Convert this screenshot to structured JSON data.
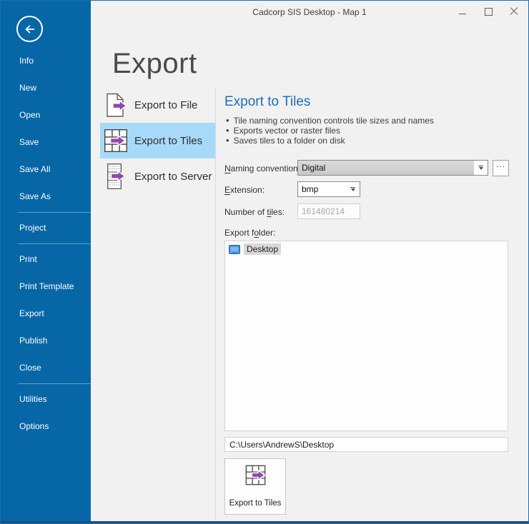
{
  "window": {
    "title": "Cadcorp SIS Desktop - Map 1"
  },
  "sidebar": {
    "items": [
      {
        "label": "Info"
      },
      {
        "label": "New"
      },
      {
        "label": "Open"
      },
      {
        "label": "Save"
      },
      {
        "label": "Save All"
      },
      {
        "label": "Save As"
      },
      {
        "label": "Project"
      },
      {
        "label": "Print"
      },
      {
        "label": "Print Template"
      },
      {
        "label": "Export"
      },
      {
        "label": "Publish"
      },
      {
        "label": "Close"
      },
      {
        "label": "Utilities"
      },
      {
        "label": "Options"
      }
    ]
  },
  "page": {
    "title": "Export"
  },
  "nav": {
    "items": [
      {
        "label": "Export to File"
      },
      {
        "label": "Export to Tiles"
      },
      {
        "label": "Export to Server"
      }
    ],
    "selected_index": 1
  },
  "panel": {
    "title": "Export to Tiles",
    "bullets": [
      "Tile naming convention controls tile sizes and names",
      "Exports vector or raster files",
      "Saves tiles to a folder on disk"
    ],
    "naming_convention": {
      "label_pre": "",
      "label_mnemonic": "N",
      "label_post": "aming convention:",
      "value": "Digital",
      "browse_label": "..."
    },
    "extension": {
      "label_pre": "",
      "label_mnemonic": "E",
      "label_post": "xtension:",
      "value": "bmp"
    },
    "number_of_tiles": {
      "label_pre": "Number of ",
      "label_mnemonic": "ti",
      "label_post": "les:",
      "value": "161480214"
    },
    "export_folder": {
      "label_pre": "Export f",
      "label_mnemonic": "o",
      "label_post": "lder:",
      "tree_items": [
        {
          "label": "Desktop"
        }
      ],
      "path": "C:\\Users\\AndrewS\\Desktop"
    },
    "action_button": {
      "label": "Export to Tiles"
    }
  },
  "colors": {
    "sidebar_blue": "#0666a6",
    "selection_blue": "#a7daf9",
    "heading_blue": "#1b6fbe",
    "arrow_purple": "#9146ad",
    "window_border_blue": "#1e6cb0",
    "bottom_strip_blue": "#1b5080"
  }
}
